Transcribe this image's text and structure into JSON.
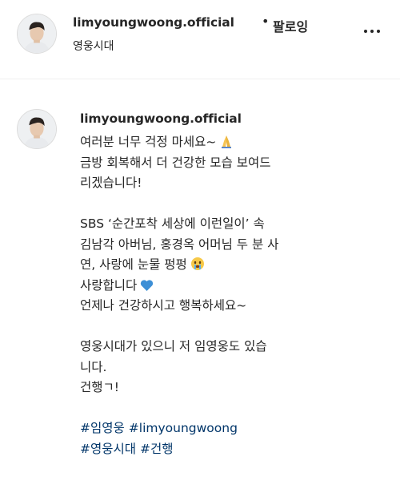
{
  "header": {
    "username": "limyoungwoong.official",
    "separator": "•",
    "follow_label": "팔로잉",
    "location": "영웅시대",
    "more_icon": "more-horizontal-icon"
  },
  "post": {
    "username": "limyoungwoong.official",
    "caption": {
      "line1": "여러분 너무 걱정 마세요~",
      "line2": "금방 회복해서 더 건강한 모습 보여드",
      "line3": "리겠습니다!",
      "line4": "SBS ‘순간포착 세상에 이런일이’ 속",
      "line5": "김남각 아버님, 홍경옥 어머님 두 분 사",
      "line6": "연, 사랑에 눈물 펑펑",
      "line7": "사랑합니다",
      "line8": "언제나 건강하시고 행복하세요~",
      "line9": "영웅시대가 있으니 저 임영웅도 있습",
      "line10": "니다.",
      "line11": "건행ㄱ!"
    },
    "emojis": [
      "folded-hands-icon",
      "crying-face-icon",
      "blue-heart-icon"
    ],
    "hashtags": [
      "#임영웅",
      "#limyoungwoong",
      "#영웅시대",
      "#건행"
    ],
    "colors": {
      "text": "#262626",
      "hashtag": "#003569",
      "divider": "#efefef",
      "heart": "#3d8fd6"
    }
  }
}
